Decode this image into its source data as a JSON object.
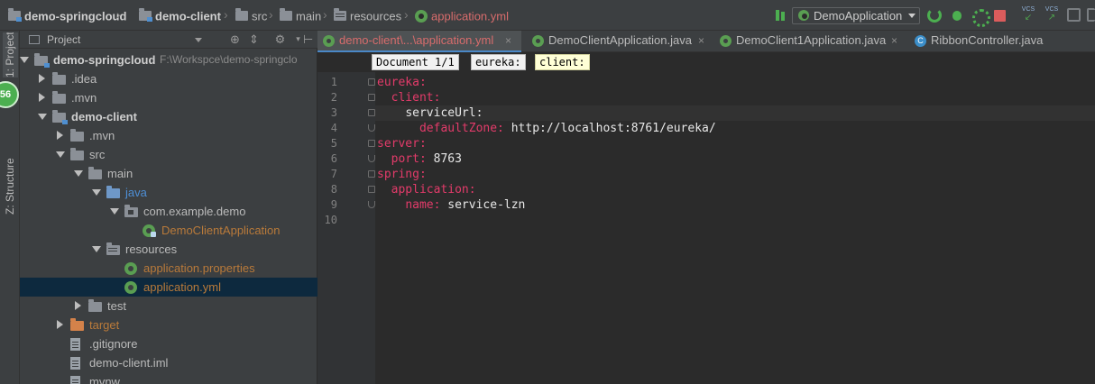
{
  "breadcrumbs": [
    {
      "label": "demo-springcloud",
      "type": "module",
      "bold": true
    },
    {
      "label": "demo-client",
      "type": "module",
      "bold": true
    },
    {
      "label": "src",
      "type": "folder"
    },
    {
      "label": "main",
      "type": "folder"
    },
    {
      "label": "resources",
      "type": "resources"
    },
    {
      "label": "application.yml",
      "type": "spring",
      "active": true
    }
  ],
  "toolbar": {
    "run_config": "DemoApplication",
    "vcs_label_1": "VCS",
    "vcs_label_2": "VCS"
  },
  "left_strip": {
    "project_tab": "1: Project",
    "structure_tab": "Z: Structure",
    "badge": "56"
  },
  "project_panel": {
    "title": "Project",
    "tree": [
      {
        "label": "demo-springcloud",
        "path": "F:\\Workspce\\demo-springclo",
        "depth": 0,
        "expanded": true,
        "icon": "module",
        "bold": true
      },
      {
        "label": ".idea",
        "depth": 1,
        "expanded": false,
        "icon": "folder"
      },
      {
        "label": ".mvn",
        "depth": 1,
        "expanded": false,
        "icon": "folder"
      },
      {
        "label": "demo-client",
        "depth": 1,
        "expanded": true,
        "icon": "module",
        "bold": true
      },
      {
        "label": ".mvn",
        "depth": 2,
        "expanded": false,
        "icon": "folder"
      },
      {
        "label": "src",
        "depth": 2,
        "expanded": true,
        "icon": "folder"
      },
      {
        "label": "main",
        "depth": 3,
        "expanded": true,
        "icon": "folder"
      },
      {
        "label": "java",
        "depth": 4,
        "expanded": true,
        "icon": "folder-blue"
      },
      {
        "label": "com.example.demo",
        "depth": 5,
        "expanded": true,
        "icon": "package"
      },
      {
        "label": "DemoClientApplication",
        "depth": 6,
        "icon": "spring-class",
        "color": "orange"
      },
      {
        "label": "resources",
        "depth": 4,
        "expanded": true,
        "icon": "resources"
      },
      {
        "label": "application.properties",
        "depth": 5,
        "icon": "spring",
        "color": "orange"
      },
      {
        "label": "application.yml",
        "depth": 5,
        "icon": "spring",
        "color": "orange",
        "selected": true
      },
      {
        "label": "test",
        "depth": 3,
        "expanded": false,
        "icon": "folder"
      },
      {
        "label": "target",
        "depth": 2,
        "expanded": false,
        "icon": "folder-orange",
        "color": "orange"
      },
      {
        "label": ".gitignore",
        "depth": 2,
        "icon": "file"
      },
      {
        "label": "demo-client.iml",
        "depth": 2,
        "icon": "file"
      },
      {
        "label": "mvnw",
        "depth": 2,
        "icon": "file"
      }
    ]
  },
  "editor": {
    "tabs": [
      {
        "label": "demo-client\\...\\application.yml",
        "icon": "spring",
        "active": true
      },
      {
        "label": "DemoClientApplication.java",
        "icon": "spring"
      },
      {
        "label": "DemoClient1Application.java",
        "icon": "spring"
      },
      {
        "label": "RibbonController.java",
        "icon": "class",
        "icon_letter": "C"
      }
    ],
    "yaml_breadcrumbs": [
      "Document 1/1",
      "eureka:",
      "client:"
    ],
    "current_line": 3,
    "lines": [
      {
        "num": "1",
        "indent": "",
        "key": "eureka:",
        "value": ""
      },
      {
        "num": "2",
        "indent": "  ",
        "key": "client:",
        "value": ""
      },
      {
        "num": "3",
        "indent": "    ",
        "key": "serviceUrl:",
        "value": "",
        "white_key": true
      },
      {
        "num": "4",
        "indent": "      ",
        "key": "defaultZone:",
        "value": " http://localhost:8761/eureka/"
      },
      {
        "num": "5",
        "indent": "",
        "key": "server:",
        "value": ""
      },
      {
        "num": "6",
        "indent": "  ",
        "key": "port:",
        "value": " 8763"
      },
      {
        "num": "7",
        "indent": "",
        "key": "spring:",
        "value": ""
      },
      {
        "num": "8",
        "indent": "  ",
        "key": "application:",
        "value": ""
      },
      {
        "num": "9",
        "indent": "    ",
        "key": "name:",
        "value": " service-lzn"
      },
      {
        "num": "10",
        "indent": "",
        "key": "",
        "value": ""
      }
    ]
  },
  "colors": {
    "yaml_key": "#e33b6a",
    "active_file": "#d86c6c",
    "selection": "#0d293e",
    "run_green": "#4caf50",
    "stop_red": "#db5c5c"
  }
}
